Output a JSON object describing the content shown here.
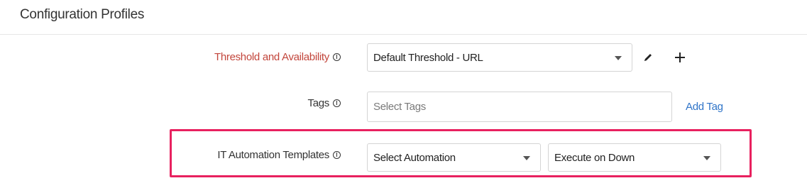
{
  "section": {
    "title": "Configuration Profiles"
  },
  "threshold": {
    "label": "Threshold and Availability",
    "selected": "Default Threshold - URL",
    "edit_icon": "pencil-icon",
    "add_icon": "plus-icon"
  },
  "tags": {
    "label": "Tags",
    "placeholder": "Select Tags",
    "add_link": "Add Tag"
  },
  "automation": {
    "label": "IT Automation Templates",
    "template_selected": "Select Automation",
    "trigger_selected": "Execute on Down",
    "highlight_color": "#e8215f"
  },
  "colors": {
    "required_label": "#c2453b",
    "link": "#2f74c8"
  }
}
